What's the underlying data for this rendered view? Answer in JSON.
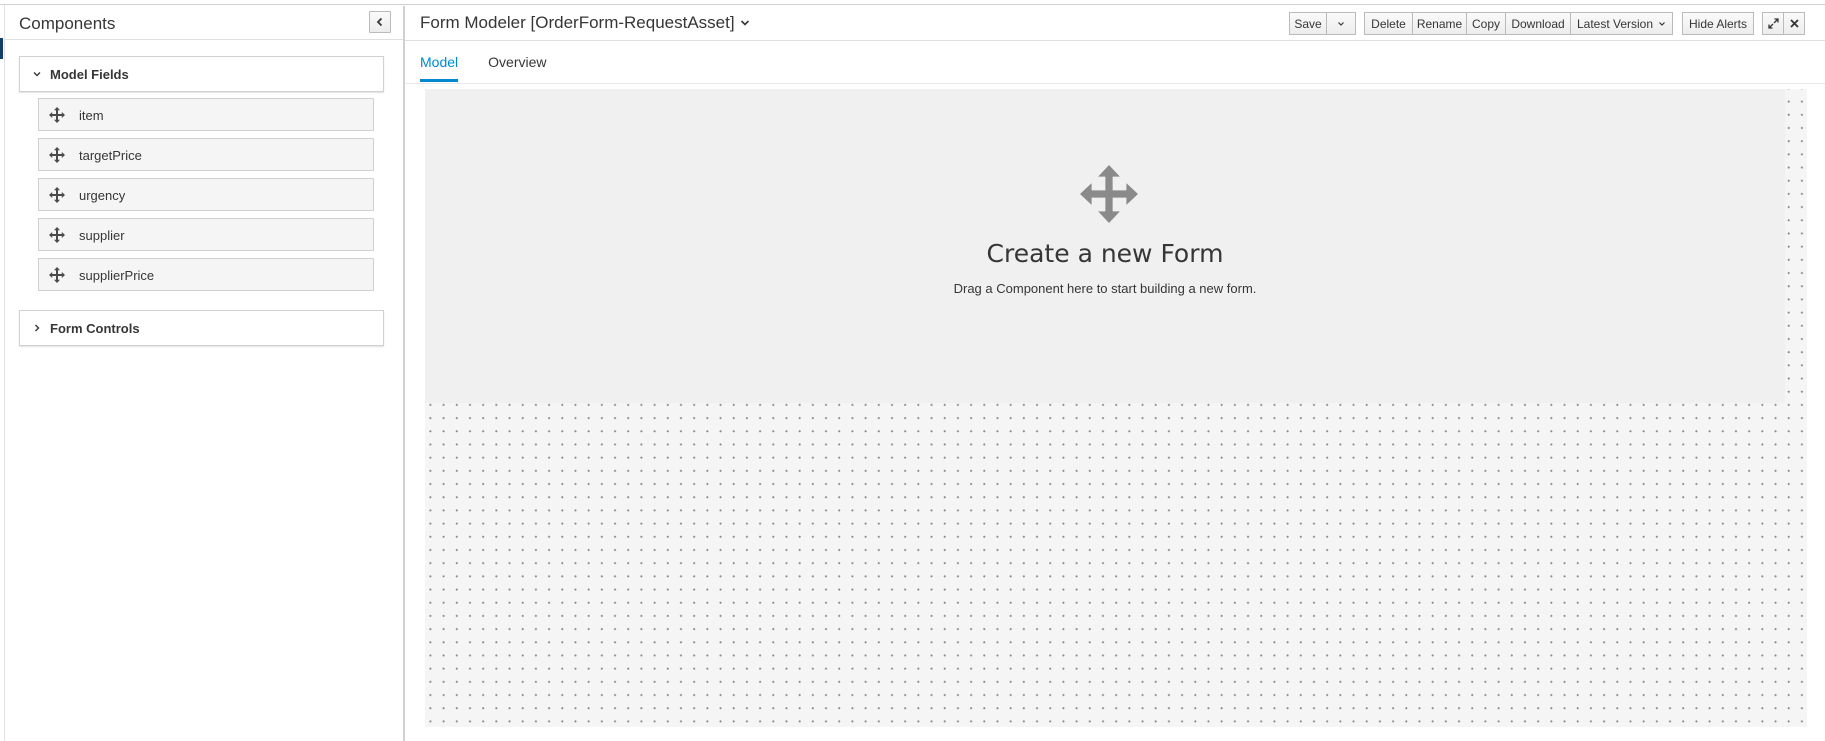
{
  "sidebar": {
    "title": "Components",
    "collapse_icon": "chevron-left-icon",
    "groups": [
      {
        "label": "Model Fields",
        "expanded": true,
        "items": [
          {
            "label": "item"
          },
          {
            "label": "targetPrice"
          },
          {
            "label": "urgency"
          },
          {
            "label": "supplier"
          },
          {
            "label": "supplierPrice"
          }
        ]
      },
      {
        "label": "Form Controls",
        "expanded": false
      }
    ]
  },
  "header": {
    "title": "Form Modeler [OrderForm-RequestAsset]",
    "toolbar": {
      "save": "Save",
      "delete": "Delete",
      "rename": "Rename",
      "copy": "Copy",
      "download": "Download",
      "latest_version": "Latest Version",
      "hide_alerts": "Hide Alerts"
    }
  },
  "tabs": [
    {
      "label": "Model",
      "active": true
    },
    {
      "label": "Overview",
      "active": false
    }
  ],
  "canvas": {
    "title": "Create a new Form",
    "subtitle": "Drag a Component here to start building a new form."
  },
  "colors": {
    "accent": "#0088ce",
    "sidebar_marker": "#0f3f6b",
    "canvas_bg": "#f5f5f5",
    "dropzone_bg": "#f0f0f0",
    "icon_gray": "#8a8a8a"
  }
}
